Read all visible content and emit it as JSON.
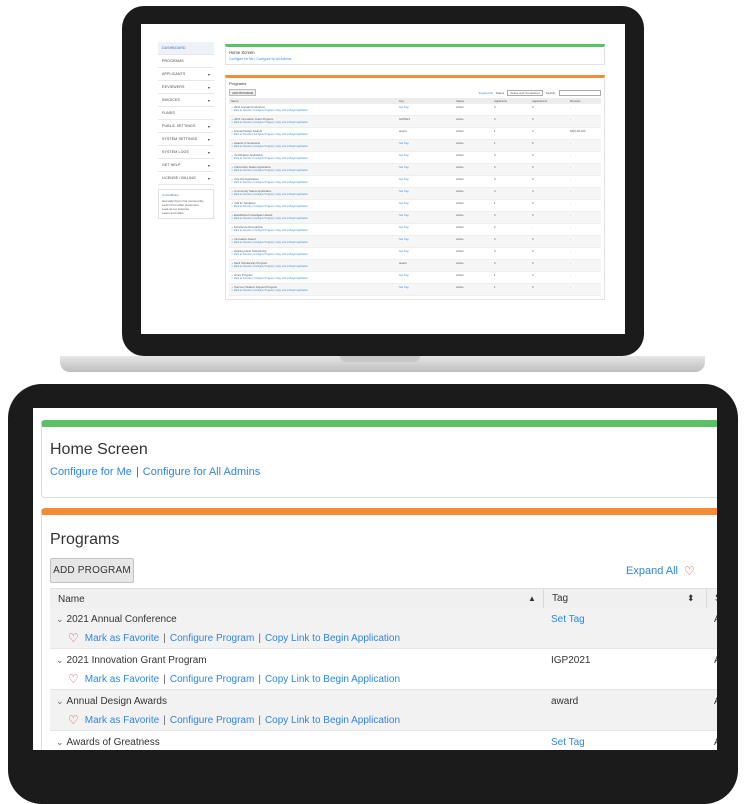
{
  "laptop": {
    "sidebar": [
      {
        "label": "DASHBOARD",
        "caret": false,
        "active": true
      },
      {
        "label": "PROGRAMS",
        "caret": false
      },
      {
        "label": "APPLICANTS",
        "caret": true
      },
      {
        "label": "REVIEWERS",
        "caret": true
      },
      {
        "label": "INVOICES",
        "caret": true
      },
      {
        "label": "FUNDS",
        "caret": false
      },
      {
        "label": "PUBLIC SETTINGS",
        "caret": true
      },
      {
        "label": "SYSTEM SETTINGS",
        "caret": true
      },
      {
        "label": "SYSTEM LOGS",
        "caret": true
      },
      {
        "label": "GET HELP",
        "caret": true
      },
      {
        "label": "LICENSE / BILLING",
        "caret": true
      }
    ],
    "notices_head": "4 Conditions",
    "notices_lines": [
      "Get Help From Our Community",
      "Learn from other customers",
      "Look at our Courses",
      "Learn and share"
    ],
    "home_title": "Home Screen",
    "home_links": "Configure for Me | Configure for All Admins",
    "programs_title": "Programs",
    "add_btn": "ADD PROGRAM",
    "expand": "Expand All",
    "status_label": "Status",
    "status_value": "Active and Completed",
    "search_label": "Search:",
    "headers": [
      "Name",
      "Tag",
      "Status",
      "Applicants",
      "Applications",
      "Reviews"
    ],
    "rows": [
      {
        "name": "2021 Annual Conference",
        "tag": "Set Tag",
        "status": "Active",
        "a": "0",
        "b": "0",
        "c": "-"
      },
      {
        "name": "2021 Innovation Grant Program",
        "tag": "IGP2021",
        "status": "Active",
        "a": "0",
        "b": "0",
        "c": "-"
      },
      {
        "name": "Annual Design Awards",
        "tag": "award",
        "status": "Active",
        "a": "1",
        "b": "4",
        "c": "DRS-00-222"
      },
      {
        "name": "Awards of Greatness",
        "tag": "Set Tag",
        "status": "Active",
        "a": "1",
        "b": "5",
        "c": "-"
      },
      {
        "name": "Certification Application",
        "tag": "Set Tag",
        "status": "Active",
        "a": "0",
        "b": "0",
        "c": "-"
      },
      {
        "name": "Citizenship Status Application",
        "tag": "Set Tag",
        "status": "Active",
        "a": "0",
        "b": "0",
        "c": "-"
      },
      {
        "name": "City Arts Application",
        "tag": "Set Tag",
        "status": "Active",
        "a": "0",
        "b": "0",
        "c": "-"
      },
      {
        "name": "Community Status Application",
        "tag": "Set Tag",
        "status": "Active",
        "a": "4",
        "b": "4",
        "c": "-"
      },
      {
        "name": "Call for Speakers",
        "tag": "Set Tag",
        "status": "Active",
        "a": "1",
        "b": "0",
        "c": "-"
      },
      {
        "name": "Established Investigator Award",
        "tag": "Set Tag",
        "status": "Active",
        "a": "0",
        "b": "0",
        "c": "-"
      },
      {
        "name": "Excellence Recognition",
        "tag": "Set Tag",
        "status": "Active",
        "a": "2",
        "b": "-",
        "c": "-"
      },
      {
        "name": "Innovation Award",
        "tag": "Set Tag",
        "status": "Active",
        "a": "0",
        "b": "0",
        "c": "-"
      },
      {
        "name": "Helping Hand Scholarship",
        "tag": "Set Tag",
        "status": "Active",
        "a": "0",
        "b": "0",
        "c": "-"
      },
      {
        "name": "Merit Scholarship Program",
        "tag": "award",
        "status": "Active",
        "a": "0",
        "b": "0",
        "c": "-"
      },
      {
        "name": "Grant Program",
        "tag": "Set Tag",
        "status": "Active",
        "a": "1",
        "b": "4",
        "c": "-"
      },
      {
        "name": "Summer Student Support Program",
        "tag": "Set Tag",
        "status": "Active",
        "a": "1",
        "b": "0",
        "c": "-"
      }
    ],
    "row_actions": "Mark as Favorite | Configure Program | Copy Link to Begin Application"
  },
  "tablet": {
    "home": {
      "title": "Home Screen",
      "configure_me": "Configure for Me",
      "separator": "|",
      "configure_all": "Configure for All Admins"
    },
    "programs": {
      "title": "Programs",
      "add_button": "ADD PROGRAM",
      "expand_all": "Expand All",
      "col_name": "Name",
      "col_tag": "Tag",
      "col_status": "Sta",
      "sort_asc_icon": "▲",
      "sort_both_icon": "⬍",
      "mark_favorite": "Mark as Favorite",
      "configure_program": "Configure Program",
      "copy_link": "Copy Link to Begin Application",
      "rows": [
        {
          "name": "2021 Annual Conference",
          "tag": "Set Tag",
          "tag_is_link": true,
          "status": "Ac"
        },
        {
          "name": "2021 Innovation Grant Program",
          "tag": "IGP2021",
          "tag_is_link": false,
          "status": "Ac"
        },
        {
          "name": "Annual Design Awards",
          "tag": "award",
          "tag_is_link": false,
          "status": "Ac"
        },
        {
          "name": "Awards of Greatness",
          "tag": "Set Tag",
          "tag_is_link": true,
          "status": "Ac"
        }
      ]
    }
  },
  "colors": {
    "green": "#5cc065",
    "orange": "#f58b34",
    "link": "#2e86de",
    "heart": "#e6454a"
  }
}
